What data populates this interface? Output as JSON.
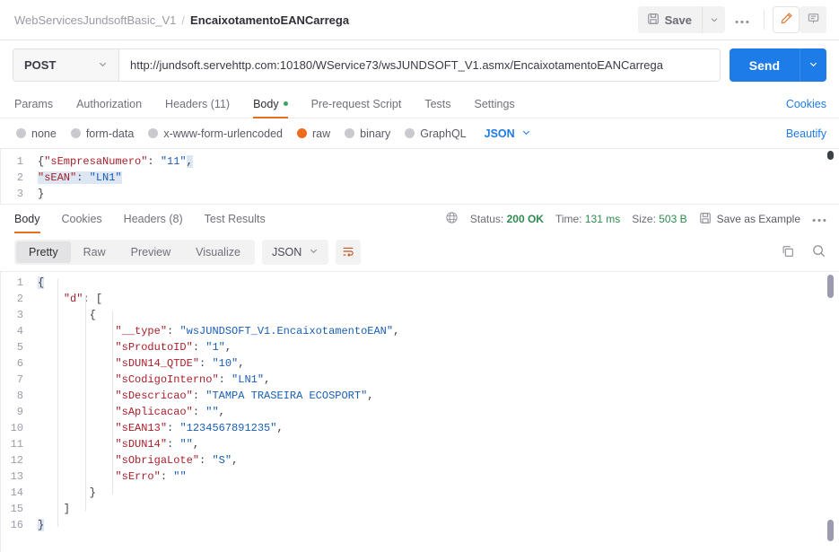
{
  "header": {
    "collection": "WebServicesJundsoftBasic_V1",
    "separator": "/",
    "request_name": "EncaixotamentoEANCarrega",
    "save_label": "Save",
    "icons": {
      "save": "floppy-disk-icon",
      "save_caret": "chevron-down-icon",
      "more": "ellipsis-icon",
      "edit": "pencil-icon",
      "comment": "comment-icon"
    }
  },
  "url_bar": {
    "method": "POST",
    "url": "http://jundsoft.servehttp.com:10180/WService73/wsJUNDSOFT_V1.asmx/EncaixotamentoEANCarrega",
    "send_label": "Send"
  },
  "request_tabs": {
    "items": [
      {
        "label": "Params",
        "active": false,
        "dot": false
      },
      {
        "label": "Authorization",
        "active": false,
        "dot": false
      },
      {
        "label": "Headers (11)",
        "active": false,
        "dot": false
      },
      {
        "label": "Body",
        "active": true,
        "dot": true
      },
      {
        "label": "Pre-request Script",
        "active": false,
        "dot": false
      },
      {
        "label": "Tests",
        "active": false,
        "dot": false
      },
      {
        "label": "Settings",
        "active": false,
        "dot": false
      }
    ],
    "cookies_label": "Cookies"
  },
  "body_type": {
    "options": [
      {
        "label": "none",
        "selected": false
      },
      {
        "label": "form-data",
        "selected": false
      },
      {
        "label": "x-www-form-urlencoded",
        "selected": false
      },
      {
        "label": "raw",
        "selected": true
      },
      {
        "label": "binary",
        "selected": false
      },
      {
        "label": "GraphQL",
        "selected": false
      }
    ],
    "format": "JSON",
    "beautify_label": "Beautify"
  },
  "request_body": {
    "lines": [
      {
        "num": "1",
        "segments": [
          {
            "t": "{",
            "c": "p"
          },
          {
            "t": "\"sEmpresaNumero\"",
            "c": "k"
          },
          {
            "t": ": ",
            "c": "p"
          },
          {
            "t": "\"11\"",
            "c": "v"
          },
          {
            "t": ",",
            "c": "p sel"
          }
        ]
      },
      {
        "num": "2",
        "segments": [
          {
            "t": "\"sEAN\"",
            "c": "k sel"
          },
          {
            "t": ": ",
            "c": "p sel"
          },
          {
            "t": "\"LN1\"",
            "c": "v sel"
          }
        ]
      },
      {
        "num": "3",
        "segments": [
          {
            "t": "}",
            "c": "p"
          }
        ]
      }
    ]
  },
  "response_tabs": {
    "items": [
      {
        "label": "Body",
        "active": true
      },
      {
        "label": "Cookies",
        "active": false
      },
      {
        "label": "Headers (8)",
        "active": false
      },
      {
        "label": "Test Results",
        "active": false
      }
    ],
    "status_label": "Status:",
    "status_value": "200 OK",
    "time_label": "Time:",
    "time_value": "131 ms",
    "size_label": "Size:",
    "size_value": "503 B",
    "save_example_label": "Save as Example",
    "more_icon": "ellipsis-icon",
    "globe_icon": "globe-icon"
  },
  "response_toolbar": {
    "views": [
      {
        "label": "Pretty",
        "active": true
      },
      {
        "label": "Raw",
        "active": false
      },
      {
        "label": "Preview",
        "active": false
      },
      {
        "label": "Visualize",
        "active": false
      }
    ],
    "format": "JSON",
    "wrap_icon": "word-wrap-icon",
    "copy_icon": "copy-icon",
    "search_icon": "search-icon"
  },
  "response_body": {
    "lines": [
      {
        "num": "1",
        "segments": [
          {
            "t": "{",
            "c": "p sel"
          }
        ]
      },
      {
        "num": "2",
        "segments": [
          {
            "t": "    ",
            "c": "p"
          },
          {
            "t": "\"d\"",
            "c": "k"
          },
          {
            "t": ": [",
            "c": "p"
          }
        ]
      },
      {
        "num": "3",
        "segments": [
          {
            "t": "        {",
            "c": "p"
          }
        ]
      },
      {
        "num": "4",
        "segments": [
          {
            "t": "            ",
            "c": "p"
          },
          {
            "t": "\"__type\"",
            "c": "k"
          },
          {
            "t": ": ",
            "c": "p"
          },
          {
            "t": "\"wsJUNDSOFT_V1.EncaixotamentoEAN\"",
            "c": "v"
          },
          {
            "t": ",",
            "c": "p"
          }
        ]
      },
      {
        "num": "5",
        "segments": [
          {
            "t": "            ",
            "c": "p"
          },
          {
            "t": "\"sProdutoID\"",
            "c": "k"
          },
          {
            "t": ": ",
            "c": "p"
          },
          {
            "t": "\"1\"",
            "c": "v"
          },
          {
            "t": ",",
            "c": "p"
          }
        ]
      },
      {
        "num": "6",
        "segments": [
          {
            "t": "            ",
            "c": "p"
          },
          {
            "t": "\"sDUN14_QTDE\"",
            "c": "k"
          },
          {
            "t": ": ",
            "c": "p"
          },
          {
            "t": "\"10\"",
            "c": "v"
          },
          {
            "t": ",",
            "c": "p"
          }
        ]
      },
      {
        "num": "7",
        "segments": [
          {
            "t": "            ",
            "c": "p"
          },
          {
            "t": "\"sCodigoInterno\"",
            "c": "k"
          },
          {
            "t": ": ",
            "c": "p"
          },
          {
            "t": "\"LN1\"",
            "c": "v"
          },
          {
            "t": ",",
            "c": "p"
          }
        ]
      },
      {
        "num": "8",
        "segments": [
          {
            "t": "            ",
            "c": "p"
          },
          {
            "t": "\"sDescricao\"",
            "c": "k"
          },
          {
            "t": ": ",
            "c": "p"
          },
          {
            "t": "\"TAMPA TRASEIRA ECOSPORT\"",
            "c": "v"
          },
          {
            "t": ",",
            "c": "p"
          }
        ]
      },
      {
        "num": "9",
        "segments": [
          {
            "t": "            ",
            "c": "p"
          },
          {
            "t": "\"sAplicacao\"",
            "c": "k"
          },
          {
            "t": ": ",
            "c": "p"
          },
          {
            "t": "\"\"",
            "c": "v"
          },
          {
            "t": ",",
            "c": "p"
          }
        ]
      },
      {
        "num": "10",
        "segments": [
          {
            "t": "            ",
            "c": "p"
          },
          {
            "t": "\"sEAN13\"",
            "c": "k"
          },
          {
            "t": ": ",
            "c": "p"
          },
          {
            "t": "\"1234567891235\"",
            "c": "v"
          },
          {
            "t": ",",
            "c": "p"
          }
        ]
      },
      {
        "num": "11",
        "segments": [
          {
            "t": "            ",
            "c": "p"
          },
          {
            "t": "\"sDUN14\"",
            "c": "k"
          },
          {
            "t": ": ",
            "c": "p"
          },
          {
            "t": "\"\"",
            "c": "v"
          },
          {
            "t": ",",
            "c": "p"
          }
        ]
      },
      {
        "num": "12",
        "segments": [
          {
            "t": "            ",
            "c": "p"
          },
          {
            "t": "\"sObrigaLote\"",
            "c": "k"
          },
          {
            "t": ": ",
            "c": "p"
          },
          {
            "t": "\"S\"",
            "c": "v"
          },
          {
            "t": ",",
            "c": "p"
          }
        ]
      },
      {
        "num": "13",
        "segments": [
          {
            "t": "            ",
            "c": "p"
          },
          {
            "t": "\"sErro\"",
            "c": "k"
          },
          {
            "t": ": ",
            "c": "p"
          },
          {
            "t": "\"\"",
            "c": "v"
          }
        ]
      },
      {
        "num": "14",
        "segments": [
          {
            "t": "        }",
            "c": "p"
          }
        ]
      },
      {
        "num": "15",
        "segments": [
          {
            "t": "    ]",
            "c": "p"
          }
        ]
      },
      {
        "num": "16",
        "segments": [
          {
            "t": "}",
            "c": "p sel"
          }
        ]
      }
    ]
  },
  "colors": {
    "accent_orange": "#e86c23",
    "link_blue": "#1e7ce8",
    "status_green": "#2e8b4f",
    "json_key": "#a8202b",
    "json_string": "#1a5fb4"
  }
}
